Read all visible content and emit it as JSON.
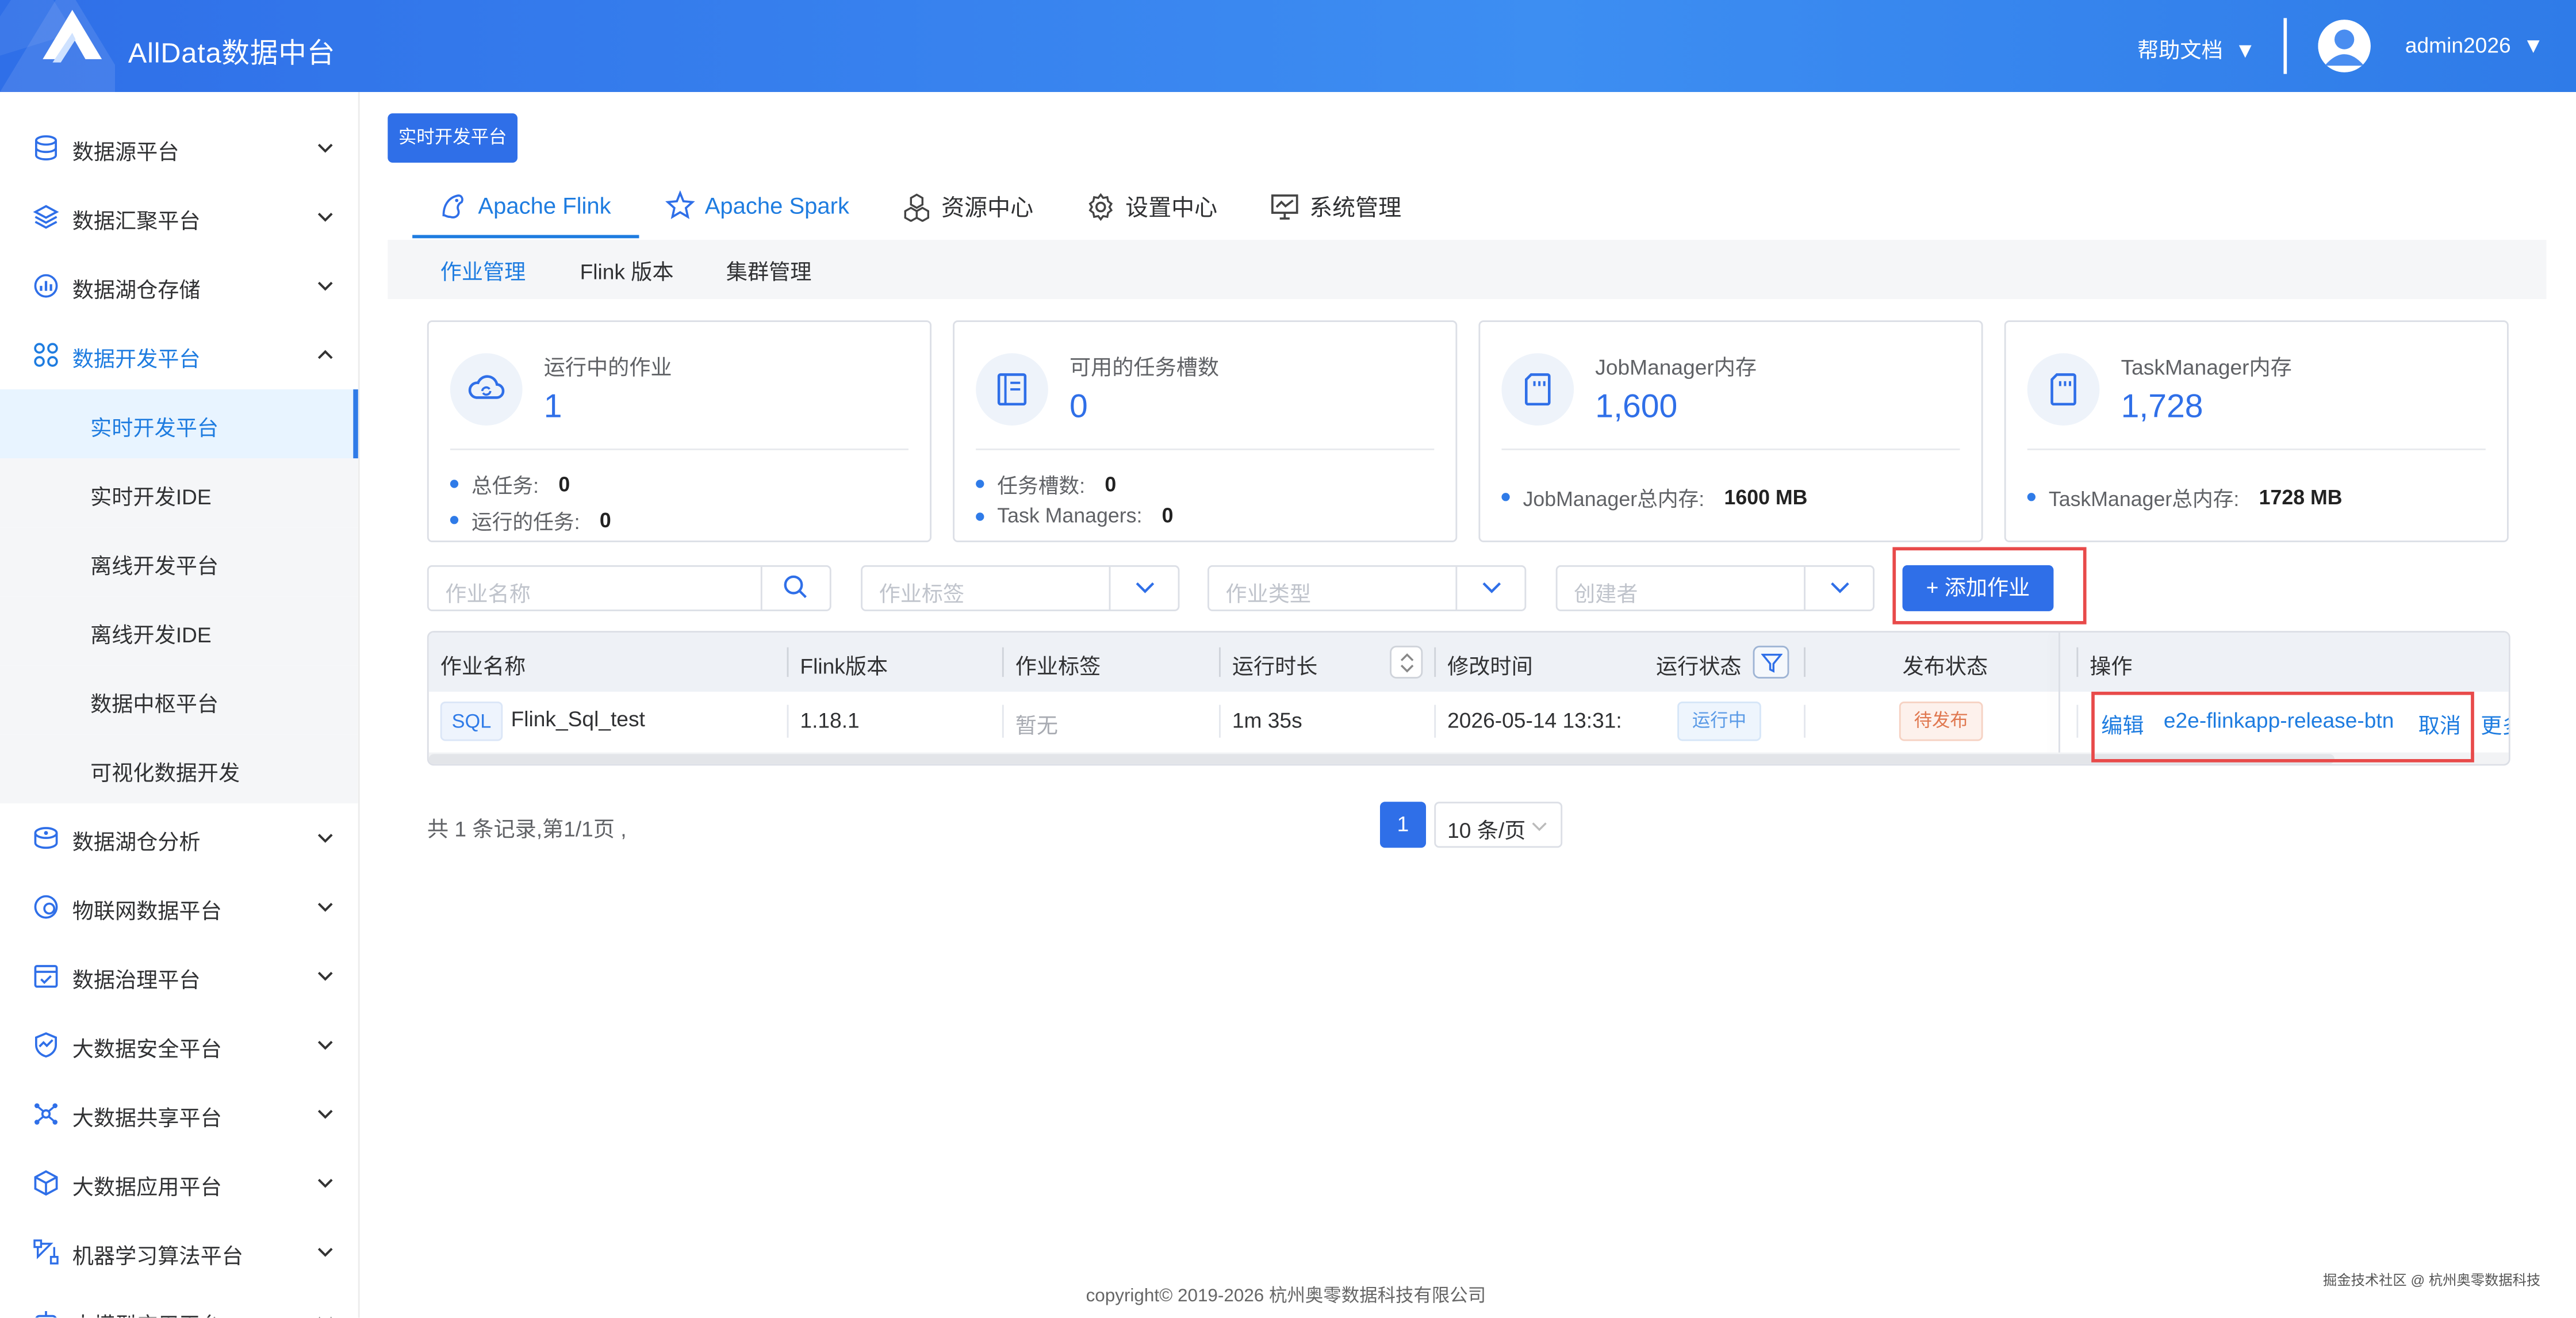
{
  "app": {
    "title": "AllData数据中台",
    "help_label": "帮助文档",
    "help_arrow": "▼",
    "user_name": "admin2026",
    "user_arrow": "▼"
  },
  "sidebar": {
    "items": [
      {
        "label": "数据源平台",
        "icon": "database-icon"
      },
      {
        "label": "数据汇聚平台",
        "icon": "layers-icon"
      },
      {
        "label": "数据湖仓存储",
        "icon": "chart-box-icon"
      },
      {
        "label": "数据开发平台",
        "icon": "grid-icon",
        "expanded": true
      },
      {
        "label": "数据湖仓分析",
        "icon": "disk-stack-icon"
      },
      {
        "label": "物联网数据平台",
        "icon": "pie-ring-icon"
      },
      {
        "label": "数据治理平台",
        "icon": "check-calendar-icon"
      },
      {
        "label": "大数据安全平台",
        "icon": "shield-chart-icon"
      },
      {
        "label": "大数据共享平台",
        "icon": "network-icon"
      },
      {
        "label": "大数据应用平台",
        "icon": "cube-icon"
      },
      {
        "label": "机器学习算法平台",
        "icon": "vector-icon"
      },
      {
        "label": "大模型应用平台",
        "icon": "robot-icon"
      }
    ],
    "subitems": [
      {
        "label": "实时开发平台",
        "active": true
      },
      {
        "label": "实时开发IDE"
      },
      {
        "label": "离线开发平台"
      },
      {
        "label": "离线开发IDE"
      },
      {
        "label": "数据中枢平台"
      },
      {
        "label": "可视化数据开发"
      }
    ]
  },
  "breadcrumb_button": "实时开发平台",
  "tabs": [
    {
      "label": "Apache Flink",
      "active": true
    },
    {
      "label": "Apache Spark"
    },
    {
      "label": "资源中心"
    },
    {
      "label": "设置中心"
    },
    {
      "label": "系统管理"
    }
  ],
  "subtabs": [
    {
      "label": "作业管理",
      "active": true
    },
    {
      "label": "Flink 版本"
    },
    {
      "label": "集群管理"
    }
  ],
  "cards": [
    {
      "title": "运行中的作业",
      "value": "1",
      "rows": [
        {
          "label": "总任务:",
          "value": "0"
        },
        {
          "label": "运行的任务:",
          "value": "0"
        }
      ]
    },
    {
      "title": "可用的任务槽数",
      "value": "0",
      "rows": [
        {
          "label": "任务槽数:",
          "value": "0"
        },
        {
          "label": "Task Managers:",
          "value": "0"
        }
      ]
    },
    {
      "title": "JobManager内存",
      "value": "1,600",
      "rows": [
        {
          "label": "JobManager总内存:",
          "value": "1600 MB"
        }
      ]
    },
    {
      "title": "TaskManager内存",
      "value": "1,728",
      "rows": [
        {
          "label": "TaskManager总内存:",
          "value": "1728 MB"
        }
      ]
    }
  ],
  "filters": {
    "job_name_placeholder": "作业名称",
    "job_tag_placeholder": "作业标签",
    "job_type_placeholder": "作业类型",
    "creator_placeholder": "创建者",
    "add_job_label": "+ 添加作业"
  },
  "table": {
    "headers": [
      "作业名称",
      "Flink版本",
      "作业标签",
      "运行时长",
      "修改时间",
      "运行状态",
      "发布状态",
      "操作"
    ],
    "rows": [
      {
        "type_tag": "SQL",
        "name": "Flink_Sql_test",
        "flink_version": "1.18.1",
        "tag": "暂无",
        "duration": "1m 35s",
        "modified": "2026-05-14 13:31:",
        "run_status": "运行中",
        "publish_status": "待发布",
        "actions": [
          "编辑",
          "e2e-flinkapp-release-btn",
          "取消",
          "更多"
        ]
      }
    ]
  },
  "pagination": {
    "info": "共 1 条记录,第1/1页 ,",
    "current": "1",
    "page_size": "10 条/页"
  },
  "footer": {
    "copyright": "copyright© 2019-2026 杭州奥零数据科技有限公司",
    "watermark": "掘金技术社区 @ 杭州奥零数据科技"
  },
  "colors": {
    "primary": "#2f6fe8",
    "active_text": "#1e7ce0",
    "highlight_border": "#e84a4a"
  }
}
